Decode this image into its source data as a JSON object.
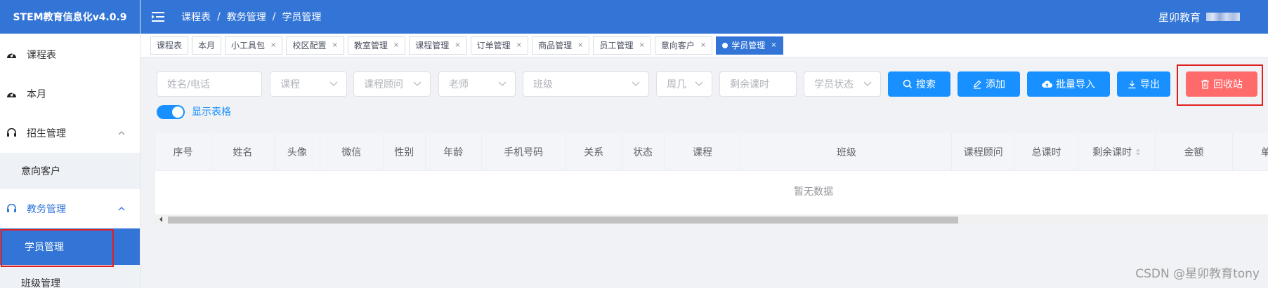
{
  "app": {
    "title": "STEM教育信息化v4.0.9"
  },
  "sidebar": {
    "items": [
      {
        "label": "课程表",
        "icon": "dashboard-icon"
      },
      {
        "label": "本月",
        "icon": "dashboard-icon"
      },
      {
        "label": "招生管理",
        "icon": "headset-icon",
        "expanded": true,
        "children": [
          {
            "label": "意向客户"
          }
        ]
      },
      {
        "label": "教务管理",
        "icon": "headset-icon",
        "expanded": true,
        "children": [
          {
            "label": "学员管理",
            "selected": true
          },
          {
            "label": "班级管理"
          }
        ]
      }
    ]
  },
  "header": {
    "breadcrumb": [
      "课程表",
      "教务管理",
      "学员管理"
    ],
    "breadcrumb_sep": "/",
    "org_name": "星卯教育"
  },
  "tags": [
    {
      "label": "课程表",
      "closable": false
    },
    {
      "label": "本月",
      "closable": false
    },
    {
      "label": "小工具包",
      "closable": true
    },
    {
      "label": "校区配置",
      "closable": true
    },
    {
      "label": "教室管理",
      "closable": true
    },
    {
      "label": "课程管理",
      "closable": true
    },
    {
      "label": "订单管理",
      "closable": true
    },
    {
      "label": "商品管理",
      "closable": true
    },
    {
      "label": "员工管理",
      "closable": true
    },
    {
      "label": "意向客户",
      "closable": true
    },
    {
      "label": "学员管理",
      "closable": true,
      "active": true
    }
  ],
  "tag_close": "×",
  "filters": {
    "name_phone": "姓名/电话",
    "course": "课程",
    "advisor": "课程顾问",
    "teacher": "老师",
    "class": "班级",
    "weekday": "周几",
    "remaining": "剩余课时",
    "status": "学员状态"
  },
  "buttons": {
    "search": "搜索",
    "add": "添加",
    "batch_import": "批量导入",
    "export": "导出",
    "recycle": "回收站"
  },
  "toggle": {
    "label": "显示表格",
    "on": true
  },
  "table": {
    "columns": [
      "序号",
      "姓名",
      "头像",
      "微信",
      "性别",
      "年龄",
      "手机号码",
      "关系",
      "状态",
      "课程",
      "班级",
      "课程顾问",
      "总课时",
      "剩余课时",
      "金额",
      "单"
    ],
    "empty_text": "暂无数据"
  },
  "watermark": "CSDN @星卯教育tony",
  "colors": {
    "primary": "#3375d6",
    "accent": "#1890ff",
    "danger": "#ff6b6b",
    "highlight": "#e02020"
  }
}
